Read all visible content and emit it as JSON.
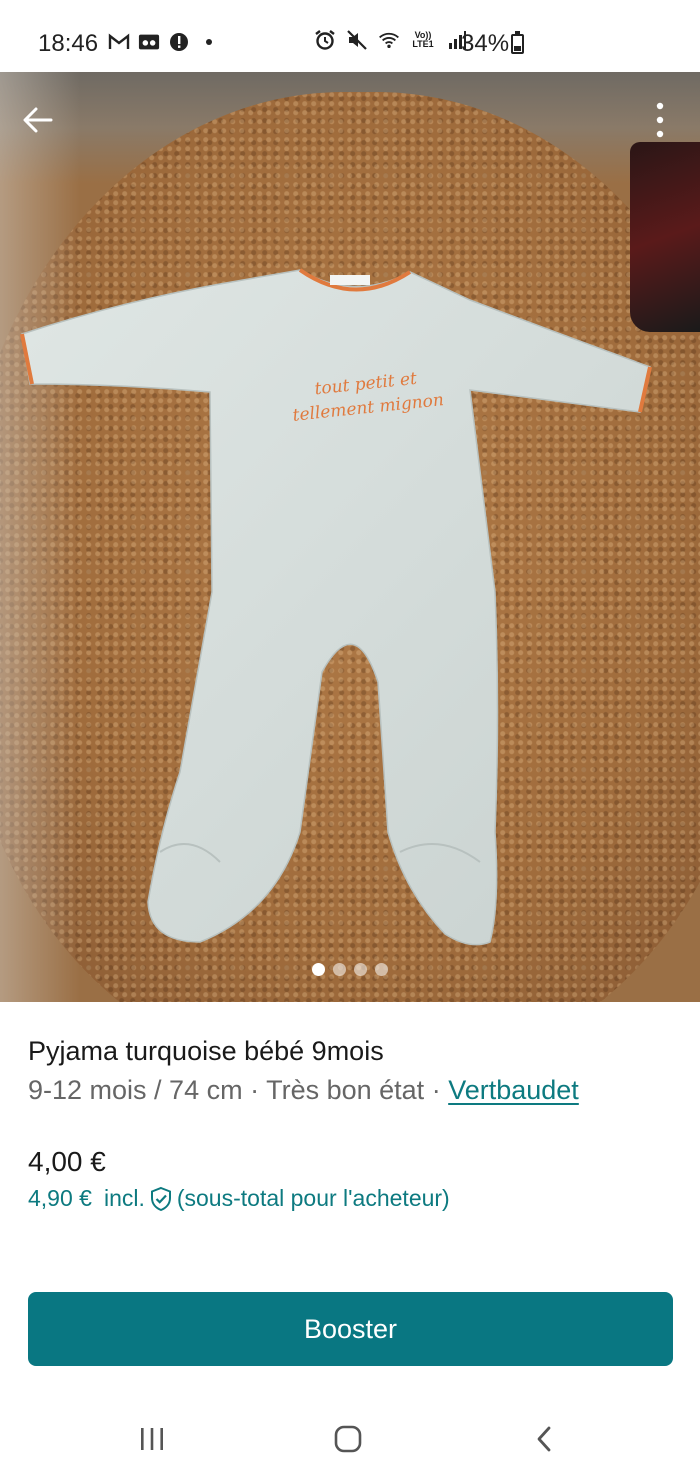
{
  "status_bar": {
    "time": "18:46",
    "left_icons": [
      "gmail-icon",
      "voicemail-icon",
      "alert-icon",
      "dot-icon"
    ],
    "right_icons": [
      "alarm-icon",
      "mute-icon",
      "wifi-icon",
      "volte-lte-icon",
      "signal-icon"
    ],
    "battery_text": "34%",
    "battery_level": 0.34,
    "lte_label": "Vo)) LTE1"
  },
  "photo": {
    "print_text_line1": "tout petit et",
    "print_text_line2": "tellement mignon",
    "carousel_count": 4,
    "carousel_active": 0
  },
  "item": {
    "title": "Pyjama turquoise bébé 9mois",
    "size": "9-12 mois / 74 cm",
    "separator": " · ",
    "condition": "Très bon état",
    "brand": "Vertbaudet",
    "price": "4,00 €",
    "total_price": "4,90 €",
    "incl_label": "incl.",
    "subtotal_note": "(sous-total pour l'acheteur)"
  },
  "actions": {
    "boost_label": "Booster"
  },
  "colors": {
    "accent": "#097782",
    "link": "#0d7a80"
  }
}
